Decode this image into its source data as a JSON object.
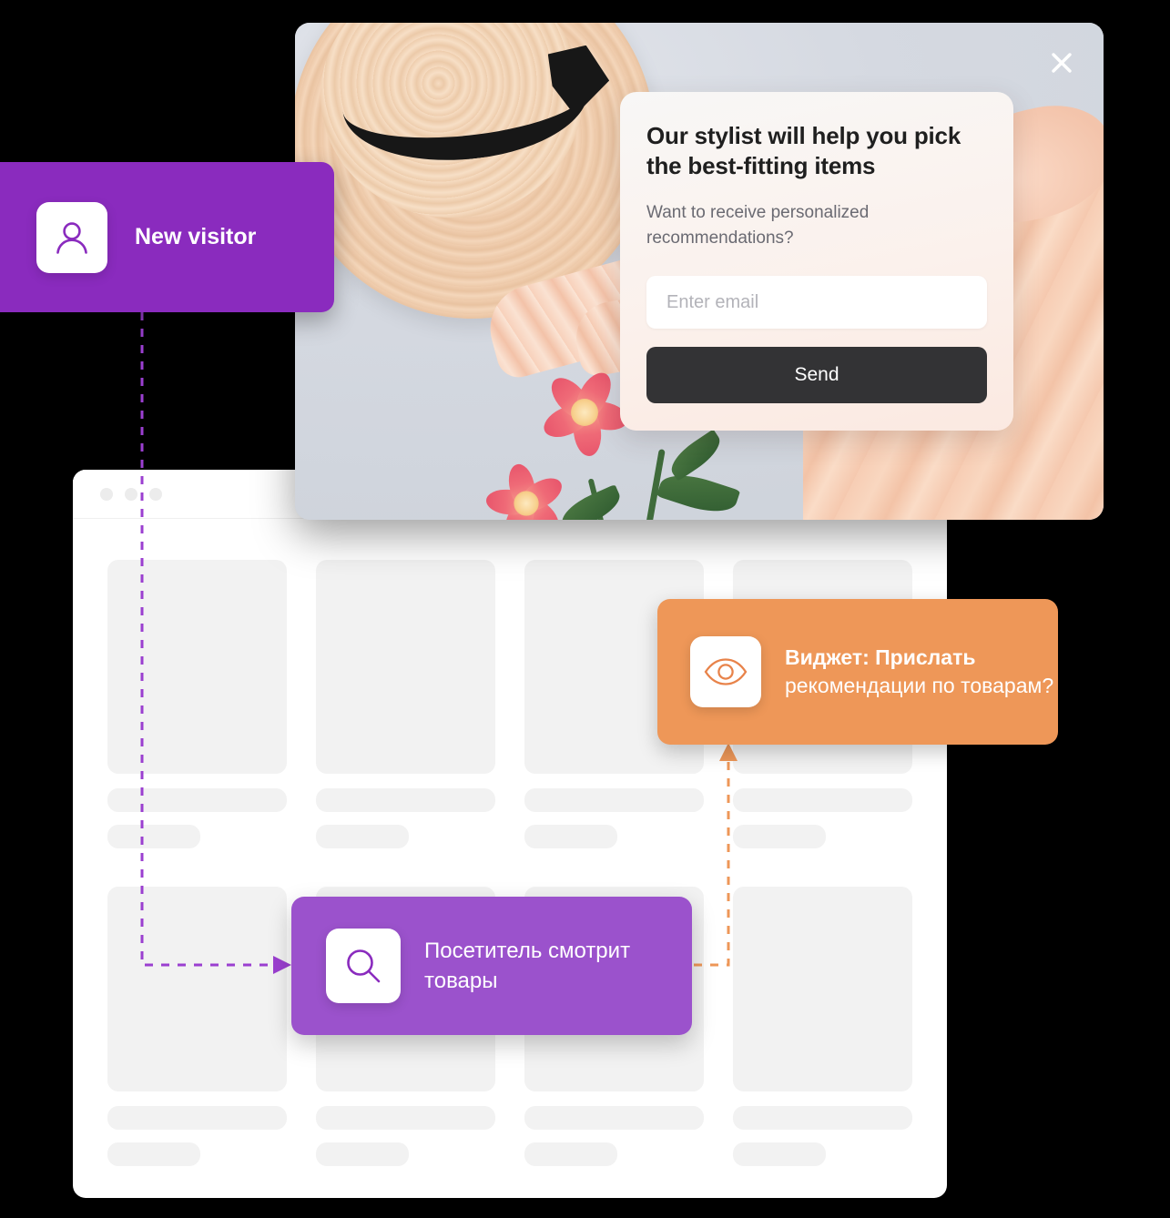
{
  "browser": {
    "name": "product-catalog-window",
    "traffic_dots": 3,
    "grid_rows": 2,
    "grid_columns": 4
  },
  "promo": {
    "name": "promo-popup",
    "close_icon": "close-icon",
    "photo_alt": "straw-hat-flowers-dress-flatlay"
  },
  "widget": {
    "title": "Our stylist will help you pick the best-fitting items",
    "subtitle": "Want to receive personalized recommendations?",
    "email_placeholder": "Enter email",
    "email_value": "",
    "send_label": "Send"
  },
  "annotations": {
    "new_visitor": {
      "label": "New visitor",
      "icon": "user-icon",
      "color": "#8A2BBE"
    },
    "widget_trigger": {
      "label_bold": "Виджет: Прислать",
      "label_rest": " рекомендации по товарам?",
      "icon": "eye-icon",
      "color": "#EE9758"
    },
    "browsing": {
      "label": "Посетитель смотрит товары",
      "icon": "search-icon",
      "color": "#9B52CC"
    }
  },
  "colors": {
    "purple_dark": "#8A2BBE",
    "purple_light": "#9B52CC",
    "orange": "#EE9758",
    "skeleton": "#f2f2f2",
    "send_button": "#333335"
  }
}
